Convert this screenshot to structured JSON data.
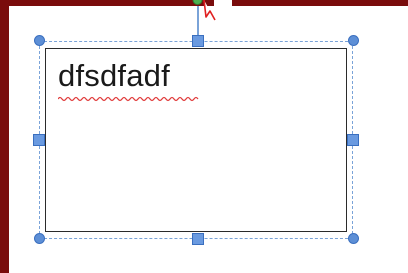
{
  "textbox": {
    "text": "dfsdfadf",
    "spellcheck_flag": "misspelled"
  },
  "colors": {
    "frame": "#7a0c0c",
    "selection": "#7aa3d8",
    "handle": "#5d8fd6",
    "rotate_handle": "#4caf50",
    "squiggle": "#e03a3a"
  },
  "icons": {
    "rotate": "rotate-handle-icon",
    "cursor": "cursor-icon"
  }
}
